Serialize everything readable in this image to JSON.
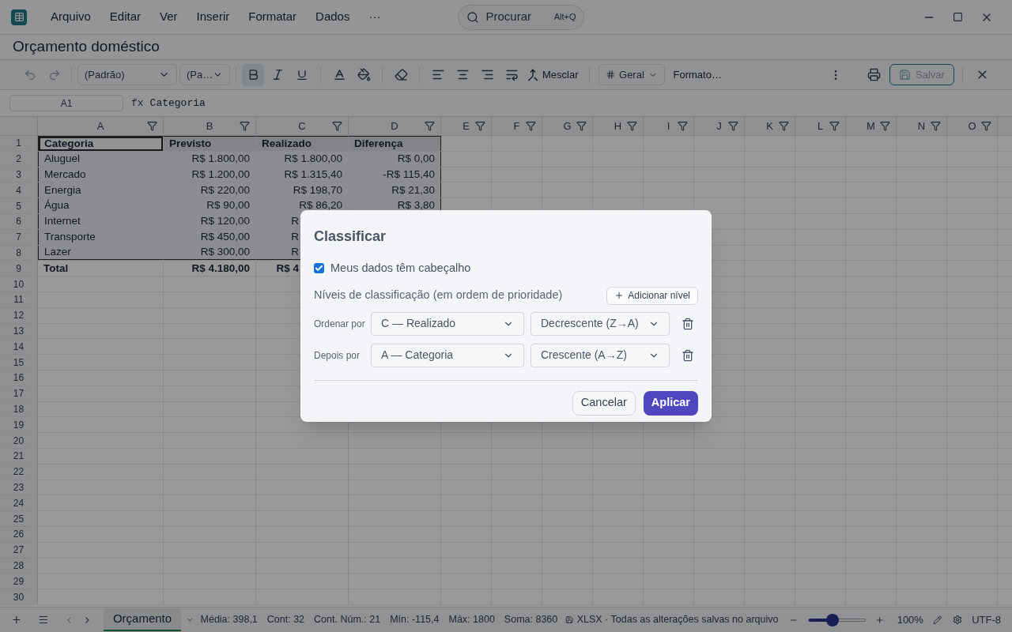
{
  "menu": {
    "items": [
      "Arquivo",
      "Editar",
      "Ver",
      "Inserir",
      "Formatar",
      "Dados"
    ],
    "more": "···",
    "search": {
      "placeholder": "Procurar",
      "shortcut": "Alt+Q"
    }
  },
  "document_title": "Orçamento doméstico",
  "toolbar": {
    "font": "(Padrão)",
    "size": "(Pa…",
    "bold": true,
    "italic": false,
    "underline": false,
    "merge": "Mesclar",
    "number_format": "Geral",
    "format_more": "Formato…",
    "save": {
      "label": "Salvar",
      "disabled": true
    }
  },
  "formula_bar": {
    "cell_ref": "A1",
    "fx": "fx",
    "value": "Categoria"
  },
  "sheet": {
    "columns": [
      "A",
      "B",
      "C",
      "D",
      "E",
      "F",
      "G",
      "H",
      "I",
      "J",
      "K",
      "L",
      "M",
      "N",
      "O"
    ],
    "rows": [
      {
        "number": "1",
        "kind": "header",
        "cells": [
          {
            "text": "Categoria",
            "kind": "text",
            "active": true
          },
          {
            "text": "Previsto",
            "kind": "text",
            "active": false
          },
          {
            "text": "Realizado",
            "kind": "text",
            "active": false
          },
          {
            "text": "Diferença",
            "kind": "text",
            "active": false
          }
        ]
      },
      {
        "number": "2",
        "kind": "data",
        "cells": [
          {
            "text": "Aluguel",
            "kind": "text",
            "active": false
          },
          {
            "text": "R$ 1.800,00",
            "kind": "number",
            "active": false
          },
          {
            "text": "R$ 1.800,00",
            "kind": "number",
            "active": false
          },
          {
            "text": "R$ 0,00",
            "kind": "number",
            "active": false
          }
        ]
      },
      {
        "number": "3",
        "kind": "data",
        "cells": [
          {
            "text": "Mercado",
            "kind": "text",
            "active": false
          },
          {
            "text": "R$ 1.200,00",
            "kind": "number",
            "active": false
          },
          {
            "text": "R$ 1.315,40",
            "kind": "number",
            "active": false
          },
          {
            "text": "-R$ 115,40",
            "kind": "number",
            "active": false
          }
        ]
      },
      {
        "number": "4",
        "kind": "data",
        "cells": [
          {
            "text": "Energia",
            "kind": "text",
            "active": false
          },
          {
            "text": "R$ 220,00",
            "kind": "number",
            "active": false
          },
          {
            "text": "R$ 198,70",
            "kind": "number",
            "active": false
          },
          {
            "text": "R$ 21,30",
            "kind": "number",
            "active": false
          }
        ]
      },
      {
        "number": "5",
        "kind": "data",
        "cells": [
          {
            "text": "Água",
            "kind": "text",
            "active": false
          },
          {
            "text": "R$ 90,00",
            "kind": "number",
            "active": false
          },
          {
            "text": "R$ 86,20",
            "kind": "number",
            "active": false
          },
          {
            "text": "R$ 3,80",
            "kind": "number",
            "active": false
          }
        ]
      },
      {
        "number": "6",
        "kind": "data",
        "cells": [
          {
            "text": "Internet",
            "kind": "text",
            "active": false
          },
          {
            "text": "R$ 120,00",
            "kind": "number",
            "active": false
          },
          {
            "text": "R",
            "kind": "cut",
            "active": false
          }
        ]
      },
      {
        "number": "7",
        "kind": "data",
        "cells": [
          {
            "text": "Transporte",
            "kind": "text",
            "active": false
          },
          {
            "text": "R$ 450,00",
            "kind": "number",
            "active": false
          },
          {
            "text": "R",
            "kind": "cut",
            "active": false
          }
        ]
      },
      {
        "number": "8",
        "kind": "data",
        "cells": [
          {
            "text": "Lazer",
            "kind": "text",
            "active": false
          },
          {
            "text": "R$ 300,00",
            "kind": "number",
            "active": false
          },
          {
            "text": "R",
            "kind": "cut",
            "active": false
          }
        ]
      },
      {
        "number": "9",
        "kind": "total",
        "cells": [
          {
            "text": "Total",
            "kind": "text",
            "active": false
          },
          {
            "text": "R$ 4.180,00",
            "kind": "number",
            "active": false
          },
          {
            "text": "R$ 4",
            "kind": "cut",
            "active": false
          }
        ]
      },
      {
        "number": "10",
        "kind": "empty"
      },
      {
        "number": "11",
        "kind": "empty"
      },
      {
        "number": "12",
        "kind": "empty"
      },
      {
        "number": "13",
        "kind": "empty"
      },
      {
        "number": "14",
        "kind": "empty"
      },
      {
        "number": "15",
        "kind": "empty"
      },
      {
        "number": "16",
        "kind": "empty"
      },
      {
        "number": "17",
        "kind": "empty"
      },
      {
        "number": "18",
        "kind": "empty"
      },
      {
        "number": "19",
        "kind": "empty"
      },
      {
        "number": "20",
        "kind": "empty"
      },
      {
        "number": "21",
        "kind": "empty"
      },
      {
        "number": "22",
        "kind": "empty"
      },
      {
        "number": "23",
        "kind": "empty"
      },
      {
        "number": "24",
        "kind": "empty"
      },
      {
        "number": "25",
        "kind": "empty"
      },
      {
        "number": "26",
        "kind": "empty"
      },
      {
        "number": "27",
        "kind": "empty"
      },
      {
        "number": "28",
        "kind": "empty"
      },
      {
        "number": "29",
        "kind": "empty"
      },
      {
        "number": "30",
        "kind": "empty"
      }
    ]
  },
  "dialog": {
    "title": "Classificar",
    "header_checkbox": {
      "label": "Meus dados têm cabeçalho",
      "checked": true
    },
    "levels_label": "Níveis de classificação (em ordem de prioridade)",
    "add_level": "Adicionar nível",
    "levels": [
      {
        "label": "Ordenar por",
        "column": "C — Realizado",
        "order": "Decrescente (Z→A)"
      },
      {
        "label": "Depois por",
        "column": "A — Categoria",
        "order": "Crescente (A→Z)"
      }
    ],
    "buttons": {
      "cancel": "Cancelar",
      "apply": "Aplicar"
    }
  },
  "status_bar": {
    "sheet_tab": {
      "label": "Orçamento",
      "selected": true
    },
    "stats": [
      "Média: 398,1",
      "Cont: 32",
      "Cont. Núm.: 21",
      "Mín: -115,4",
      "Máx: 1800",
      "Soma: 8360"
    ],
    "file_status": "XLSX · Todas as alterações salvas no arquivo",
    "zoom": {
      "level": 0.43,
      "reading": "100%"
    },
    "encoding": "UTF-8"
  }
}
